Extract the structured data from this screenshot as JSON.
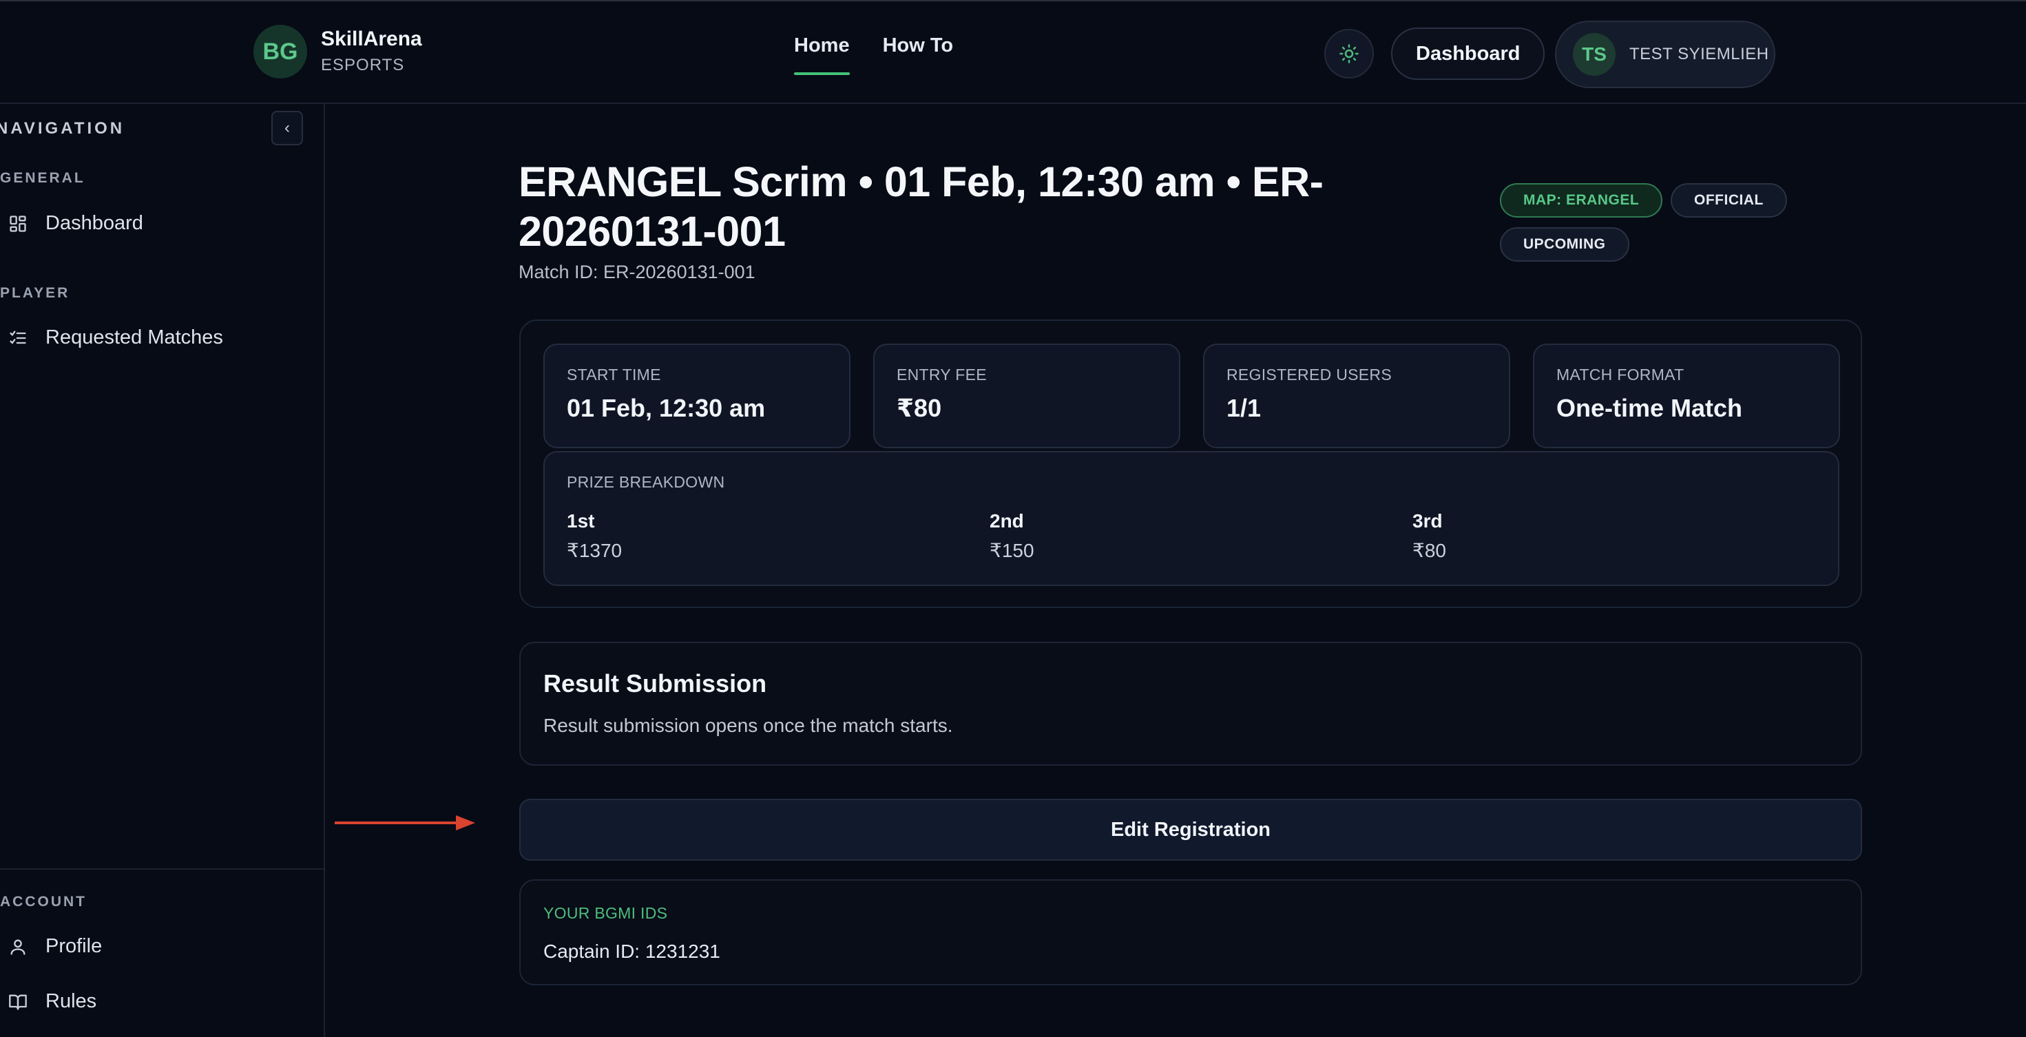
{
  "brand": {
    "logo": "BG",
    "name": "SkillArena",
    "sub": "ESPORTS"
  },
  "topnav": [
    {
      "label": "Home"
    },
    {
      "label": "How To"
    }
  ],
  "header": {
    "theme_icon": "sun-icon",
    "dashboard_label": "Dashboard",
    "user_initials": "TS",
    "user_name": "TEST SYIEMLIEH"
  },
  "sidebar": {
    "title": "NAVIGATION",
    "collapse": "‹",
    "general_label": "GENERAL",
    "dashboard": "Dashboard",
    "player_label": "PLAYER",
    "requested": "Requested Matches",
    "account_label": "ACCOUNT",
    "profile": "Profile",
    "rules": "Rules"
  },
  "match": {
    "title": "ERANGEL Scrim • 01 Feb, 12:30 am • ER-20260131-001",
    "id_line": "Match ID: ER-20260131-001",
    "badges": {
      "map": "MAP: ERANGEL",
      "official": "OFFICIAL",
      "status": "UPCOMING"
    }
  },
  "stats": [
    {
      "label": "START TIME",
      "value": "01 Feb, 12:30 am"
    },
    {
      "label": "ENTRY FEE",
      "value": "₹80"
    },
    {
      "label": "REGISTERED USERS",
      "value": "1/1"
    },
    {
      "label": "MATCH FORMAT",
      "value": "One-time Match"
    }
  ],
  "prize": {
    "label": "PRIZE BREAKDOWN",
    "items": [
      {
        "place": "1st",
        "amount": "₹1370"
      },
      {
        "place": "2nd",
        "amount": "₹150"
      },
      {
        "place": "3rd",
        "amount": "₹80"
      }
    ]
  },
  "result": {
    "title": "Result Submission",
    "text": "Result submission opens once the match starts."
  },
  "edit_label": "Edit Registration",
  "ids": {
    "label": "YOUR BGMI IDS",
    "captain": "Captain ID: 1231231"
  },
  "colors": {
    "accent": "#43c17a",
    "background": "#070b16",
    "card": "#0f1524",
    "arrow": "#d9432f"
  }
}
